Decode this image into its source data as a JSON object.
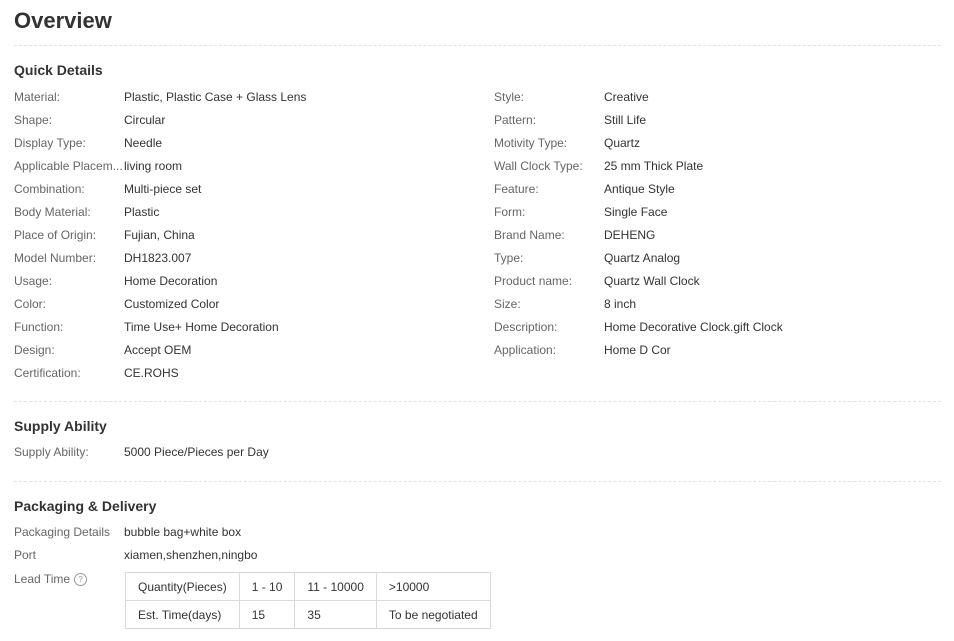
{
  "title": "Overview",
  "quick_details": {
    "heading": "Quick Details",
    "left": [
      {
        "label": "Material:",
        "value": "Plastic, Plastic Case + Glass Lens"
      },
      {
        "label": "Shape:",
        "value": "Circular"
      },
      {
        "label": "Display Type:",
        "value": "Needle"
      },
      {
        "label": "Applicable Placem...",
        "value": "living room"
      },
      {
        "label": "Combination:",
        "value": "Multi-piece set"
      },
      {
        "label": "Body Material:",
        "value": "Plastic"
      },
      {
        "label": "Place of Origin:",
        "value": "Fujian, China"
      },
      {
        "label": "Model Number:",
        "value": "DH1823.007"
      },
      {
        "label": "Usage:",
        "value": "Home Decoration"
      },
      {
        "label": "Color:",
        "value": "Customized Color"
      },
      {
        "label": "Function:",
        "value": "Time Use+ Home Decoration"
      },
      {
        "label": "Design:",
        "value": "Accept OEM"
      },
      {
        "label": "Certification:",
        "value": "CE.ROHS"
      }
    ],
    "right": [
      {
        "label": "Style:",
        "value": "Creative"
      },
      {
        "label": "Pattern:",
        "value": "Still Life"
      },
      {
        "label": "Motivity Type:",
        "value": "Quartz"
      },
      {
        "label": "Wall Clock Type:",
        "value": "25 mm Thick Plate"
      },
      {
        "label": "Feature:",
        "value": "Antique Style"
      },
      {
        "label": "Form:",
        "value": "Single Face"
      },
      {
        "label": "Brand Name:",
        "value": "DEHENG"
      },
      {
        "label": "Type:",
        "value": "Quartz Analog"
      },
      {
        "label": "Product name:",
        "value": "Quartz Wall Clock"
      },
      {
        "label": "Size:",
        "value": "8 inch"
      },
      {
        "label": "Description:",
        "value": "Home Decorative Clock.gift Clock"
      },
      {
        "label": "Application:",
        "value": "Home D Cor"
      }
    ]
  },
  "supply_ability": {
    "heading": "Supply Ability",
    "label": "Supply Ability:",
    "value": "5000 Piece/Pieces per Day"
  },
  "packaging": {
    "heading": "Packaging & Delivery",
    "details_label": "Packaging Details",
    "details_value": "bubble bag+white box",
    "port_label": "Port",
    "port_value": "xiamen,shenzhen,ningbo",
    "lead_time_label": "Lead Time",
    "help_icon": "help-circle-icon",
    "help_glyph": "?",
    "lead_table": [
      [
        "Quantity(Pieces)",
        "1 - 10",
        "11 - 10000",
        ">10000"
      ],
      [
        "Est. Time(days)",
        "15",
        "35",
        "To be negotiated"
      ]
    ]
  }
}
